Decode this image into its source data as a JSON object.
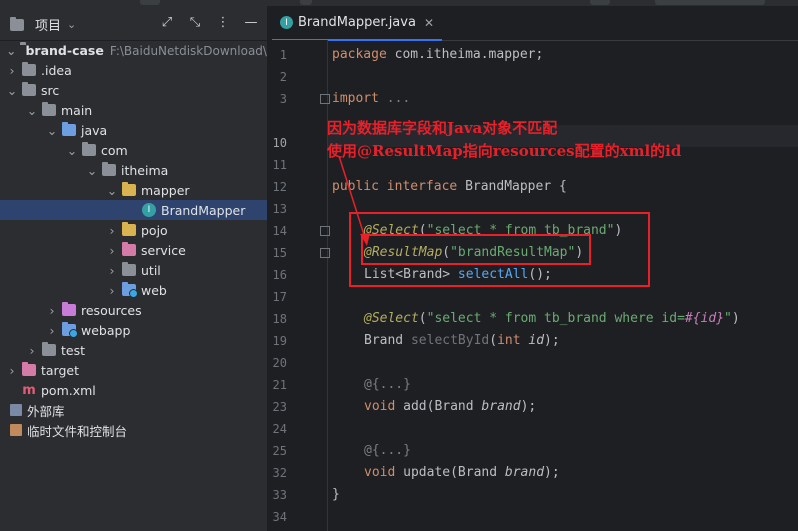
{
  "project_panel": {
    "title": "项目",
    "tree": [
      {
        "label": "brand-case",
        "path": "F:\\BaiduNetdiskDownload\\资"
      },
      {
        "label": ".idea"
      },
      {
        "label": "src"
      },
      {
        "label": "main"
      },
      {
        "label": "java"
      },
      {
        "label": "com"
      },
      {
        "label": "itheima"
      },
      {
        "label": "mapper"
      },
      {
        "label": "BrandMapper"
      },
      {
        "label": "pojo"
      },
      {
        "label": "service"
      },
      {
        "label": "util"
      },
      {
        "label": "web"
      },
      {
        "label": "resources"
      },
      {
        "label": "webapp"
      },
      {
        "label": "test"
      },
      {
        "label": "target"
      },
      {
        "label": "pom.xml"
      },
      {
        "label": "外部库"
      },
      {
        "label": "临时文件和控制台"
      }
    ]
  },
  "editor": {
    "tab_label": "BrandMapper.java",
    "line_numbers": [
      "1",
      "2",
      "3",
      "10",
      "11",
      "12",
      "13",
      "14",
      "15",
      "16",
      "17",
      "18",
      "19",
      "20",
      "21",
      "23",
      "24",
      "25",
      "32",
      "33",
      "34"
    ],
    "lines": {
      "l1a": "package ",
      "l1b": "com.itheima.mapper;",
      "l3a": "import ",
      "l3b": "...",
      "l12a": "public interface ",
      "l12b": "BrandMapper {",
      "l14a": "@Select",
      "l14b": "(",
      "l14c": "\"select * from tb_brand\"",
      "l14d": ")",
      "l15a": "@ResultMap",
      "l15b": "(",
      "l15c": "\"brandResultMap\"",
      "l15d": ")",
      "l16a": "List<Brand> ",
      "l16b": "selectAll",
      "l16c": "();",
      "l18a": "@Select",
      "l18b": "(",
      "l18c": "\"select * from tb_brand where id=",
      "l18d": "#{id}",
      "l18e": "\"",
      "l18f": ")",
      "l19a": "Brand ",
      "l19b": "selectById",
      "l19c": "(",
      "l19d": "int ",
      "l19e": "id",
      "l19f": ");",
      "l21": "@{...}",
      "l23a": "void ",
      "l23b": "add",
      "l23c": "(Brand ",
      "l23d": "brand",
      "l23e": ");",
      "l25": "@{...}",
      "l32a": "void ",
      "l32b": "update",
      "l32c": "(Brand ",
      "l32d": "brand",
      "l32e": ");",
      "l33": "}"
    }
  },
  "annotation": {
    "line1": "因为数据库字段和Java对象不匹配",
    "line2": "使用@ResultMap指向resources配置的xml的id"
  },
  "colors": {
    "annotation_red": "#e8202a",
    "keyword": "#cf8e6d",
    "annotation_yellow": "#b3ae60",
    "string_green": "#6aab73",
    "method_blue": "#56a8f5"
  }
}
